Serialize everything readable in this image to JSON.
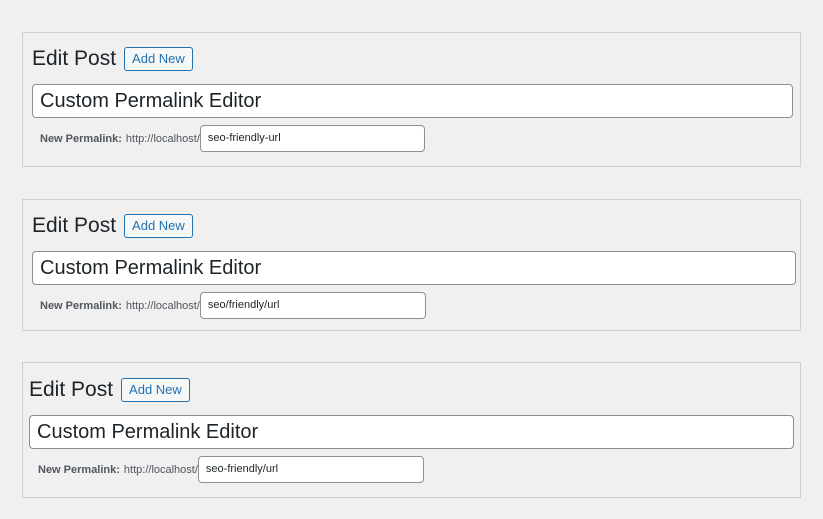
{
  "panels": [
    {
      "heading": "Edit Post",
      "add_new_label": "Add New",
      "title_value": "Custom Permalink Editor",
      "permalink_label": "New Permalink:",
      "permalink_base": "http://localhost/",
      "slug_value": "seo-friendly-url"
    },
    {
      "heading": "Edit Post",
      "add_new_label": "Add New",
      "title_value": "Custom Permalink Editor",
      "permalink_label": "New Permalink:",
      "permalink_base": "http://localhost/",
      "slug_value": "seo/friendly/url"
    },
    {
      "heading": "Edit Post",
      "add_new_label": "Add New",
      "title_value": "Custom Permalink Editor",
      "permalink_label": "New Permalink:",
      "permalink_base": "http://localhost/",
      "slug_value": "seo-friendly/url"
    }
  ],
  "colors": {
    "background": "#f0f0f1",
    "accent": "#2271b1",
    "border": "#8c8f94"
  }
}
